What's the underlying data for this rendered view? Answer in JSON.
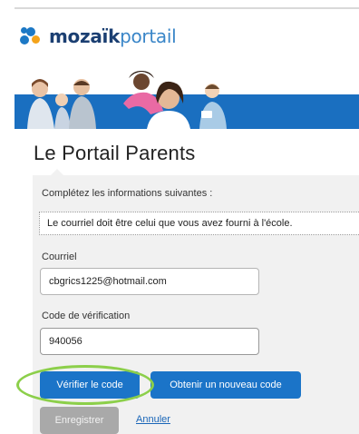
{
  "brand": {
    "name_bold": "mozaïk",
    "name_light": "portail"
  },
  "page": {
    "title": "Le Portail Parents"
  },
  "form": {
    "instructions": "Complétez les informations suivantes :",
    "notice": "Le courriel doit être celui que vous avez fourni à l'école.",
    "email_label": "Courriel",
    "email_value": "cbgrics1225@hotmail.com",
    "code_label": "Code de vérification",
    "code_value": "940056"
  },
  "actions": {
    "verify_label": "Vérifier le code",
    "new_code_label": "Obtenir un nouveau code",
    "save_label": "Enregistrer",
    "cancel_label": "Annuler"
  },
  "colors": {
    "primary_button": "#1b74c8",
    "disabled_button": "#a9a9a9",
    "banner_band": "#1a6fc0",
    "highlight_ring": "#8ccf4a",
    "brand_dark": "#1b3f72",
    "brand_accent": "#f4a31a"
  }
}
